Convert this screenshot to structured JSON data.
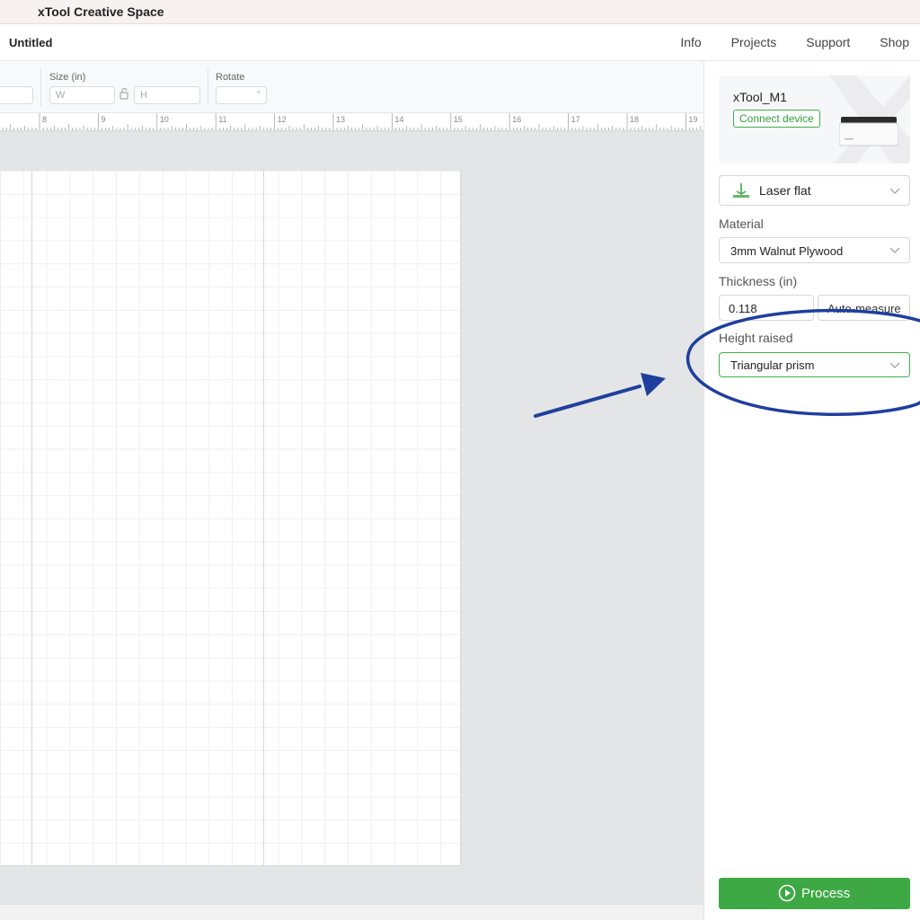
{
  "app": {
    "title": "xTool Creative Space"
  },
  "menubar": {
    "doc_title": "Untitled",
    "nav": [
      "Info",
      "Projects",
      "Support",
      "Shop"
    ]
  },
  "toolbar": {
    "size_label": "Size (in)",
    "width_placeholder": "W",
    "height_placeholder": "H",
    "rotate_label": "Rotate",
    "rotate_unit": "°"
  },
  "ruler": {
    "ticks": [
      "8",
      "9",
      "10",
      "11",
      "12",
      "13",
      "14",
      "15",
      "16",
      "17",
      "18",
      "19"
    ]
  },
  "panel": {
    "device": {
      "name": "xTool_M1",
      "connect_label": "Connect device"
    },
    "mode": {
      "value": "Laser flat",
      "icon": "laser-flat-icon"
    },
    "material": {
      "label": "Material",
      "value": "3mm Walnut Plywood"
    },
    "thickness": {
      "label": "Thickness (in)",
      "value": "0.118",
      "auto_label": "Auto-measure"
    },
    "height": {
      "label": "Height raised",
      "value": "Triangular prism"
    },
    "process": {
      "label": "Process",
      "icon": "play-circle-icon"
    }
  },
  "colors": {
    "accent_green": "#3ea844",
    "annotation_blue": "#1f3f9e"
  }
}
